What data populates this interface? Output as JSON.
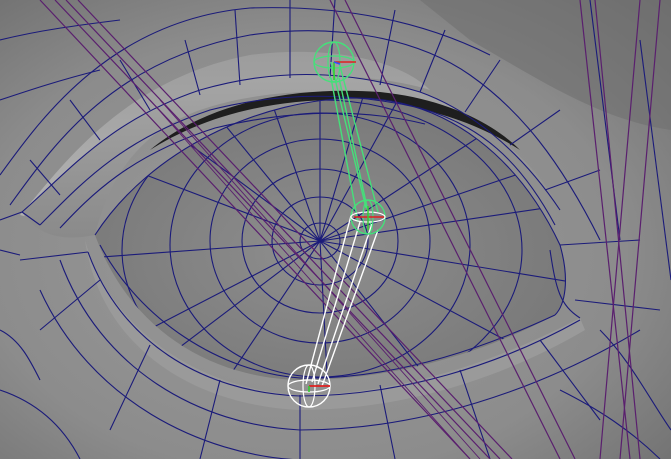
{
  "viewport": {
    "kind": "3d-modeling-viewport",
    "shading": "wireframe-on-shaded",
    "subject": "eye",
    "colors": {
      "background": "#808080",
      "skin_light": "#a8a8a8",
      "skin_dark": "#5a5a5a",
      "eyeball": "#8c8c8c",
      "lid_shadow": "#1e1e1e",
      "wireframe": "#1b1b7a",
      "curve": "#5a1f6e",
      "joint_selected": "#45e07a",
      "joint": "#ffffff",
      "axis_x": "#e02020",
      "axis_y": "#30d030",
      "axis_z": "#3050ff"
    }
  },
  "joints": [
    {
      "name": "upper-lid-joint",
      "state": "selected"
    },
    {
      "name": "eye-center-joint",
      "state": "selected"
    },
    {
      "name": "lower-lid-joint",
      "state": "normal"
    }
  ]
}
